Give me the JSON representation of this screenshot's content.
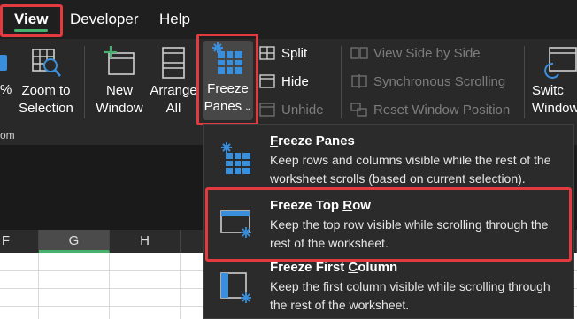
{
  "tabs": {
    "view": "View",
    "developer": "Developer",
    "help": "Help"
  },
  "ribbon": {
    "partial_left_label": "%",
    "group_label_fragment": "om",
    "zoom_to_selection": [
      "Zoom to",
      "Selection"
    ],
    "new_window": [
      "New",
      "Window"
    ],
    "arrange_all": [
      "Arrange",
      "All"
    ],
    "freeze_panes": [
      "Freeze",
      "Panes"
    ],
    "split": "Split",
    "hide": "Hide",
    "unhide": "Unhide",
    "view_side_by_side": "View Side by Side",
    "synchronous_scrolling": "Synchronous Scrolling",
    "reset_window_position": "Reset Window Position",
    "switch_windows": [
      "Switc",
      "Window"
    ]
  },
  "columns": [
    {
      "label": "F",
      "selected": false
    },
    {
      "label": "G",
      "selected": true
    },
    {
      "label": "H",
      "selected": false
    }
  ],
  "menu": {
    "items": [
      {
        "title": "Freeze Panes",
        "mnemonic": "F",
        "description": "Keep rows and columns visible while the rest of the worksheet scrolls (based on current selection)."
      },
      {
        "title": "Freeze Top Row",
        "mnemonic": "R",
        "description": "Keep the top row visible while scrolling through the rest of the worksheet."
      },
      {
        "title": "Freeze First Column",
        "mnemonic": "C",
        "description": "Keep the first column visible while scrolling through the rest of the worksheet."
      }
    ]
  },
  "colors": {
    "highlight": "#e23a3e",
    "accent": "#46b06c",
    "icon_blue": "#3a8fdc"
  },
  "icons": [
    "zoom-to-selection-icon",
    "new-window-icon",
    "arrange-all-icon",
    "freeze-panes-icon",
    "split-icon",
    "hide-icon",
    "unhide-icon",
    "view-side-by-side-icon",
    "synchronous-scrolling-icon",
    "reset-window-position-icon",
    "switch-windows-icon",
    "freeze-top-row-icon",
    "freeze-first-column-icon"
  ]
}
